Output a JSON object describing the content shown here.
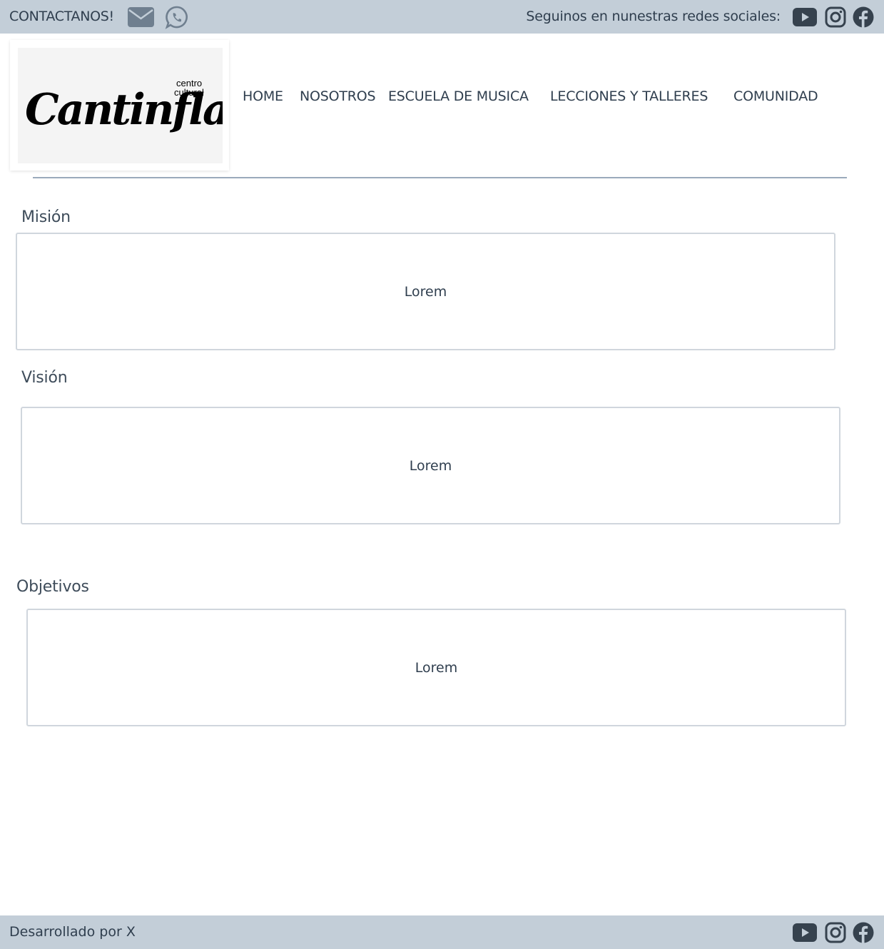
{
  "topbar": {
    "contact_label": "CONTACTANOS!",
    "contact_icons": [
      "envelope-icon",
      "whatsapp-icon"
    ],
    "follow_label": "Seguinos en nunestras redes sociales:",
    "social_icons": [
      "youtube-icon",
      "instagram-icon",
      "facebook-icon"
    ]
  },
  "logo": {
    "script_text": "Cantinflas!",
    "small_text_1": "centro",
    "small_text_2": "cultural"
  },
  "nav": {
    "items": [
      {
        "label": "HOME"
      },
      {
        "label": "NOSOTROS"
      },
      {
        "label": "ESCUELA DE MUSICA"
      },
      {
        "label": "LECCIONES Y TALLERES"
      },
      {
        "label": "COMUNIDAD"
      }
    ]
  },
  "sections": [
    {
      "title": "Misión",
      "body": "Lorem"
    },
    {
      "title": "Visión",
      "body": "Lorem"
    },
    {
      "title": "Objetivos",
      "body": "Lorem"
    }
  ],
  "footer": {
    "dev_label": "Desarrollado por X",
    "social_icons": [
      "youtube-icon",
      "instagram-icon",
      "facebook-icon"
    ]
  },
  "colors": {
    "bar_bg": "#c3ced8",
    "text": "#2f3e4e",
    "icon": "#36424e",
    "contact_icon": "#6f7f8f",
    "divider": "#9aaabb",
    "box_border": "#d0d6dd"
  }
}
